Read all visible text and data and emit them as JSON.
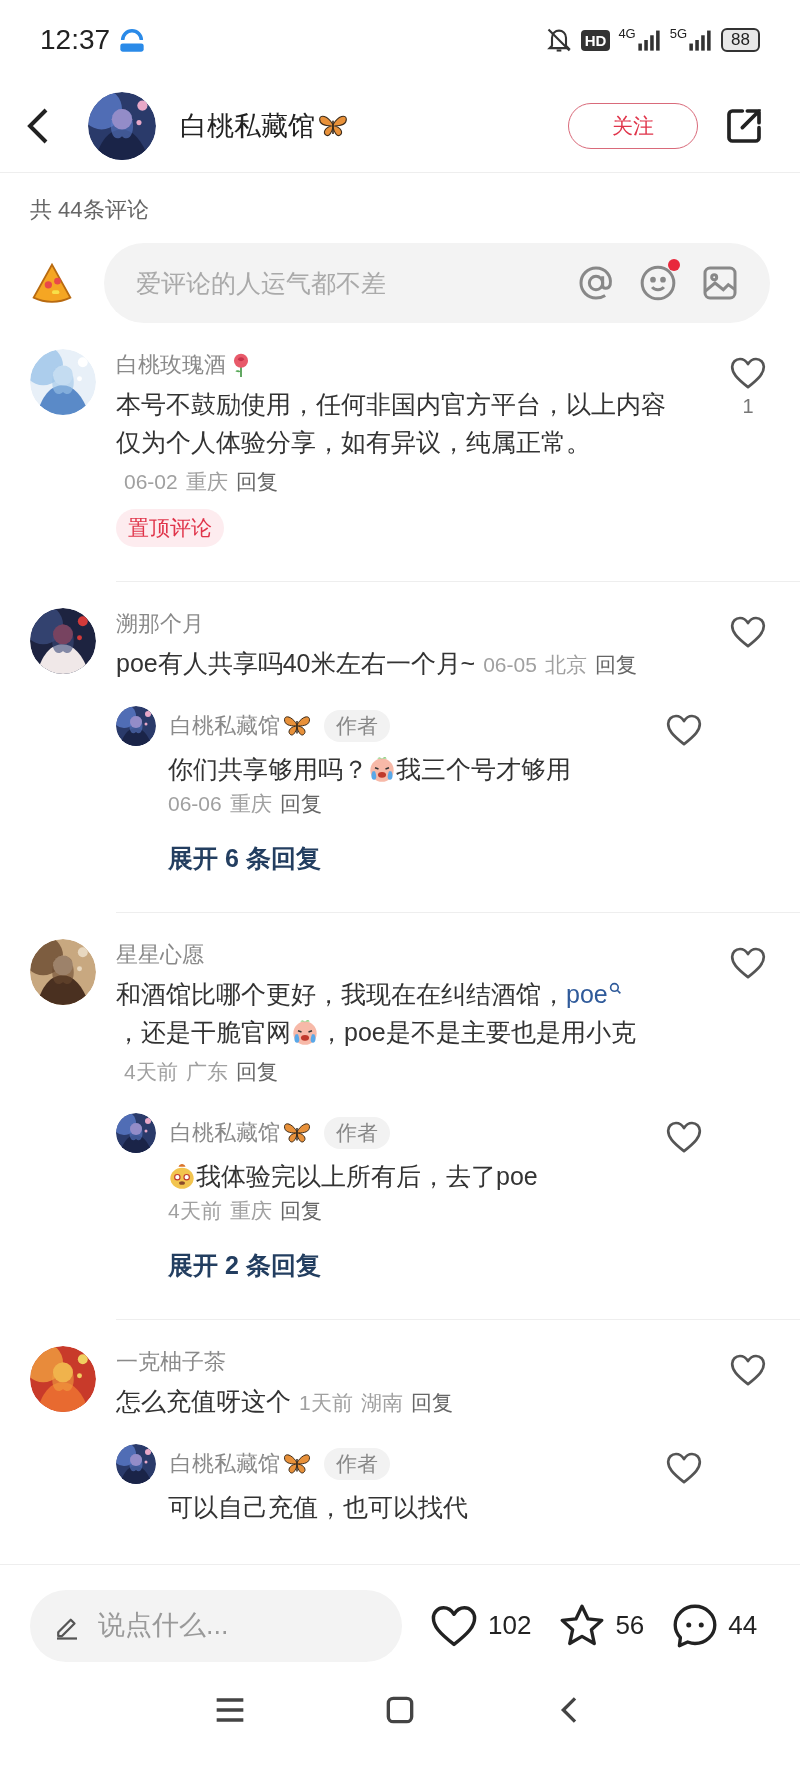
{
  "status_bar": {
    "time": "12:37",
    "hd": "HD",
    "network_1": "4G",
    "network_2": "5G",
    "battery": "88"
  },
  "header": {
    "title": "白桃私藏馆",
    "follow_button": "关注"
  },
  "comment_count": "共 44条评论",
  "composer": {
    "placeholder": "爱评论的人运气都不差",
    "emoji_badge": true
  },
  "comments": [
    {
      "author": [
        {
          "kind": "text",
          "text": "白桃玫瑰酒"
        },
        {
          "kind": "rose"
        }
      ],
      "body": [
        {
          "kind": "text",
          "text": "本号不鼓励使用，任何非国内官方平台，以上内容仅为个人体验分享，如有异议，纯属正常。"
        }
      ],
      "date": "06-02",
      "location": "重庆",
      "reply": "回复",
      "likes": "1",
      "pinned": "置顶评论"
    },
    {
      "author": [
        {
          "kind": "text",
          "text": "溯那个月"
        }
      ],
      "body": [
        {
          "kind": "text",
          "text": "poe有人共享吗40米左右一个月~"
        }
      ],
      "date": "06-05",
      "location": "北京",
      "reply": "回复",
      "replies": [
        {
          "author": [
            {
              "kind": "text",
              "text": "白桃私藏馆"
            },
            {
              "kind": "butterfly"
            }
          ],
          "badge": "作者",
          "body": [
            {
              "kind": "text",
              "text": "你们共享够用吗？"
            },
            {
              "kind": "crying"
            },
            {
              "kind": "text",
              "text": "我三个号才够用"
            }
          ],
          "date": "06-06",
          "location": "重庆",
          "reply": "回复"
        }
      ],
      "expand": "展开 6 条回复"
    },
    {
      "author": [
        {
          "kind": "text",
          "text": "星星心愿"
        }
      ],
      "body": [
        {
          "kind": "text",
          "text": "和酒馆比哪个更好，我现在在纠结酒馆，"
        },
        {
          "kind": "link",
          "text": "poe"
        },
        {
          "kind": "text",
          "text": "，还是干脆官网"
        },
        {
          "kind": "crying"
        },
        {
          "kind": "text",
          "text": "，poe是不是主要也是用小克"
        }
      ],
      "date": "4天前",
      "location": "广东",
      "reply": "回复",
      "replies": [
        {
          "author": [
            {
              "kind": "text",
              "text": "白桃私藏馆"
            },
            {
              "kind": "butterfly"
            }
          ],
          "badge": "作者",
          "body": [
            {
              "kind": "puppy"
            },
            {
              "kind": "text",
              "text": "我体验完以上所有后，去了poe"
            }
          ],
          "date": "4天前",
          "location": "重庆",
          "reply": "回复"
        }
      ],
      "expand": "展开 2 条回复"
    },
    {
      "author": [
        {
          "kind": "text",
          "text": "一克柚子茶"
        }
      ],
      "body": [
        {
          "kind": "text",
          "text": "怎么充值呀这个"
        }
      ],
      "date": "1天前",
      "location": "湖南",
      "reply": "回复",
      "replies": [
        {
          "author": [
            {
              "kind": "text",
              "text": "白桃私藏馆"
            },
            {
              "kind": "butterfly"
            }
          ],
          "badge": "作者",
          "body": [
            {
              "kind": "text",
              "text": "可以自己充值，也可以找代"
            }
          ]
        }
      ]
    }
  ],
  "bottom_bar": {
    "placeholder": "说点什么...",
    "likes": "102",
    "favorites": "56",
    "comments": "44"
  }
}
